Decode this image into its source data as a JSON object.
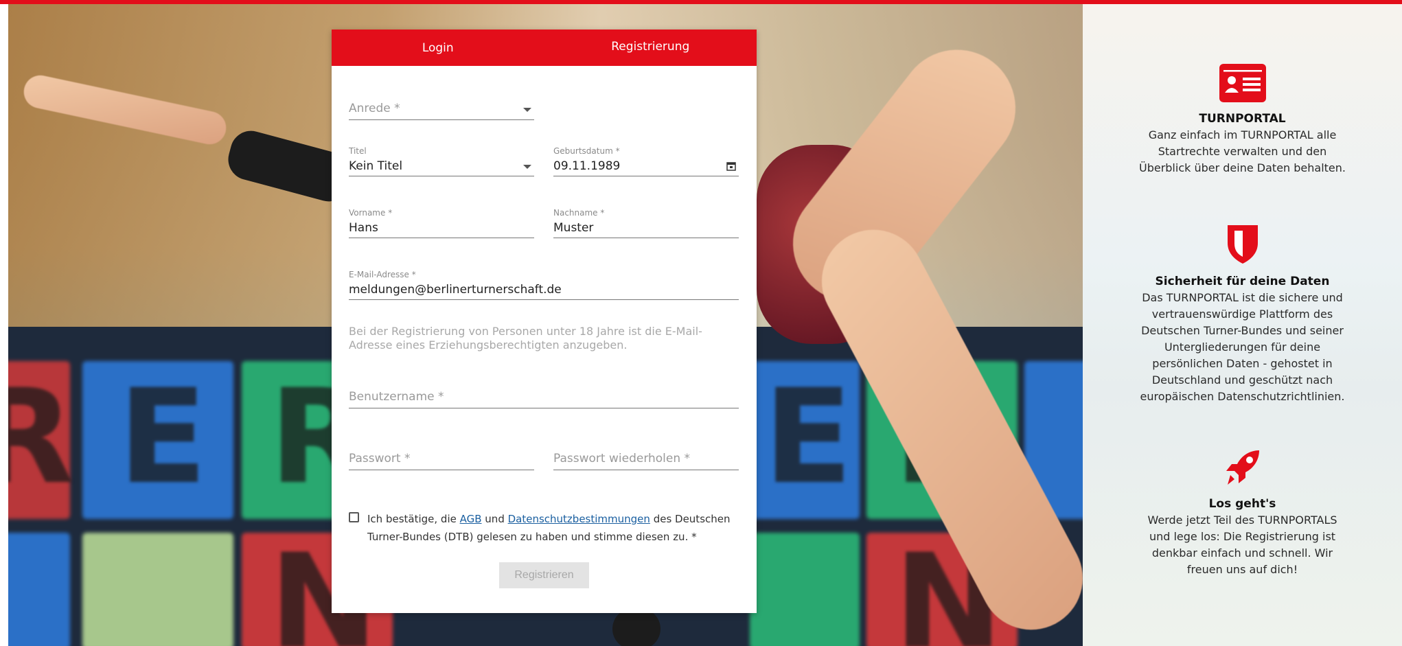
{
  "tabs": {
    "login": "Login",
    "register": "Registrierung"
  },
  "form": {
    "anrede": {
      "placeholder": "Anrede *"
    },
    "titel": {
      "label": "Titel",
      "value": "Kein Titel"
    },
    "geburtsdatum": {
      "label": "Geburtsdatum *",
      "value": "09.11.1989"
    },
    "vorname": {
      "label": "Vorname *",
      "value": "Hans"
    },
    "nachname": {
      "label": "Nachname *",
      "value": "Muster"
    },
    "email": {
      "label": "E-Mail-Adresse *",
      "value": "meldungen@berlinerturnerschaft.de"
    },
    "hint": "Bei der Registrierung von Personen unter 18 Jahre ist die E-Mail-Adresse eines Erziehungsberechtigten anzugeben.",
    "benutzername": {
      "placeholder": "Benutzername *"
    },
    "passwort": {
      "placeholder": "Passwort *"
    },
    "passwort_wiederholen": {
      "placeholder": "Passwort wiederholen *"
    },
    "consent": {
      "prefix": "Ich bestätige, die ",
      "agb": "AGB",
      "und": " und ",
      "datenschutz": "Datenschutzbestimmungen",
      "suffix": " des Deutschen Turner-Bundes (DTB) gelesen zu haben und stimme diesen zu. *"
    },
    "submit": "Registrieren"
  },
  "info": [
    {
      "icon": "id-card-icon",
      "title": "TURNPORTAL",
      "text": "Ganz einfach im TURNPORTAL alle Startrechte verwalten und den Überblick über deine Daten behalten."
    },
    {
      "icon": "shield-icon",
      "title": "Sicherheit für deine Daten",
      "text": "Das TURNPORTAL ist die sichere und vertrauenswürdige Plattform des Deutschen Turner-Bundes und seiner Untergliederungen für deine persönlichen Daten - gehostet in Deutschland und geschützt nach europäischen Datenschutzrichtlinien."
    },
    {
      "icon": "rocket-icon",
      "title": "Los geht's",
      "text": "Werde jetzt Teil des TURNPORTALS und lege los: Die Registrierung ist denkbar einfach und schnell. Wir freuen uns auf dich!"
    }
  ],
  "colors": {
    "brand": "#e30e1a",
    "link": "#1a5fa0"
  }
}
